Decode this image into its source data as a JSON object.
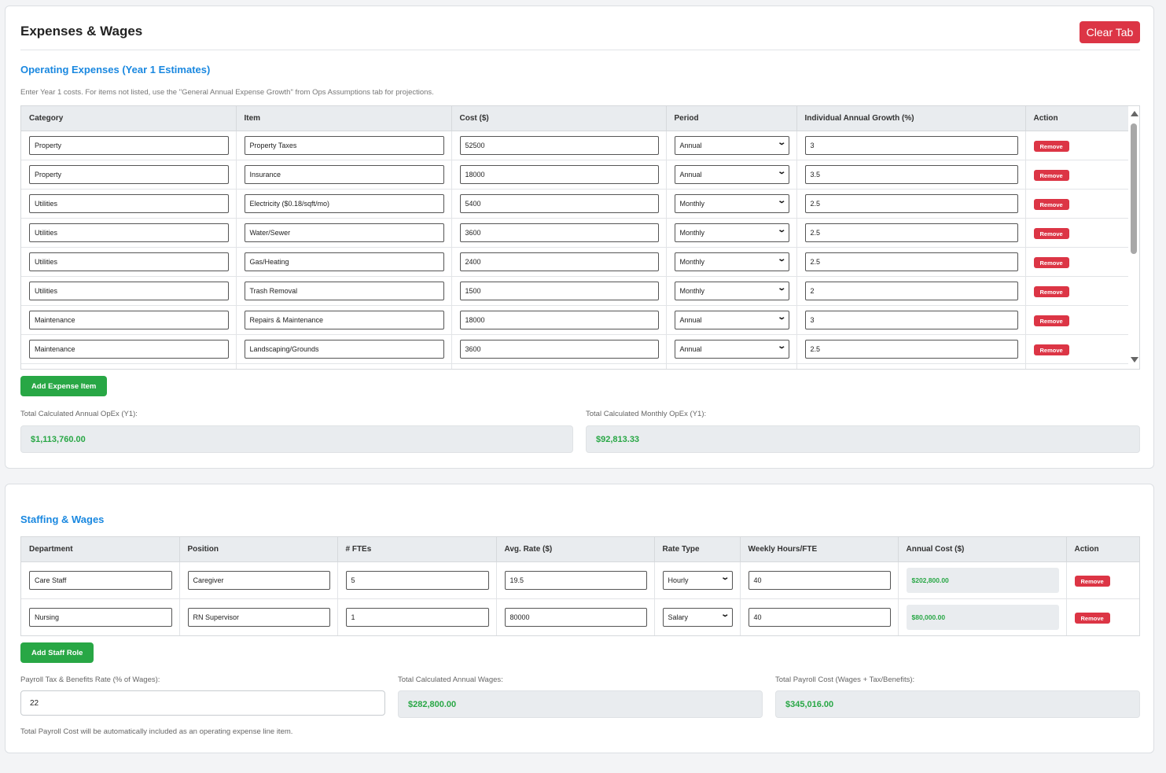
{
  "page": {
    "title": "Expenses & Wages",
    "clear_label": "Clear Tab"
  },
  "opex": {
    "section_title": "Operating Expenses (Year 1 Estimates)",
    "hint": "Enter Year 1 costs. For items not listed, use the \"General Annual Expense Growth\" from Ops Assumptions tab for projections.",
    "columns": [
      "Category",
      "Item",
      "Cost ($)",
      "Period",
      "Individual Annual Growth (%)",
      "Action"
    ],
    "rows": [
      {
        "category": "Property",
        "item": "Property Taxes",
        "cost": "52500",
        "period": "Annual",
        "growth": "3"
      },
      {
        "category": "Property",
        "item": "Insurance",
        "cost": "18000",
        "period": "Annual",
        "growth": "3.5"
      },
      {
        "category": "Utilities",
        "item": "Electricity ($0.18/sqft/mo)",
        "cost": "5400",
        "period": "Monthly",
        "growth": "2.5"
      },
      {
        "category": "Utilities",
        "item": "Water/Sewer",
        "cost": "3600",
        "period": "Monthly",
        "growth": "2.5"
      },
      {
        "category": "Utilities",
        "item": "Gas/Heating",
        "cost": "2400",
        "period": "Monthly",
        "growth": "2.5"
      },
      {
        "category": "Utilities",
        "item": "Trash Removal",
        "cost": "1500",
        "period": "Monthly",
        "growth": "2"
      },
      {
        "category": "Maintenance",
        "item": "Repairs & Maintenance",
        "cost": "18000",
        "period": "Annual",
        "growth": "3"
      },
      {
        "category": "Maintenance",
        "item": "Landscaping/Grounds",
        "cost": "3600",
        "period": "Annual",
        "growth": "2.5"
      }
    ],
    "remove_label": "Remove",
    "add_label": "Add Expense Item",
    "total_annual_label": "Total Calculated Annual OpEx (Y1):",
    "total_annual_value": "$1,113,760.00",
    "total_monthly_label": "Total Calculated Monthly OpEx (Y1):",
    "total_monthly_value": "$92,813.33"
  },
  "staffing": {
    "section_title": "Staffing & Wages",
    "columns": [
      "Department",
      "Position",
      "# FTEs",
      "Avg. Rate ($)",
      "Rate Type",
      "Weekly Hours/FTE",
      "Annual Cost ($)",
      "Action"
    ],
    "rows": [
      {
        "department": "Care Staff",
        "position": "Caregiver",
        "ftes": "5",
        "rate": "19.5",
        "rate_type": "Hourly",
        "hours": "40",
        "annual_cost": "$202,800.00"
      },
      {
        "department": "Nursing",
        "position": "RN Supervisor",
        "ftes": "1",
        "rate": "80000",
        "rate_type": "Salary",
        "hours": "40",
        "annual_cost": "$80,000.00"
      }
    ],
    "remove_label": "Remove",
    "add_label": "Add Staff Role",
    "payroll_rate_label": "Payroll Tax & Benefits Rate (% of Wages):",
    "payroll_rate_value": "22",
    "total_wages_label": "Total Calculated Annual Wages:",
    "total_wages_value": "$282,800.00",
    "total_payroll_label": "Total Payroll Cost (Wages + Tax/Benefits):",
    "total_payroll_value": "$345,016.00",
    "footnote": "Total Payroll Cost will be automatically included as an operating expense line item."
  }
}
